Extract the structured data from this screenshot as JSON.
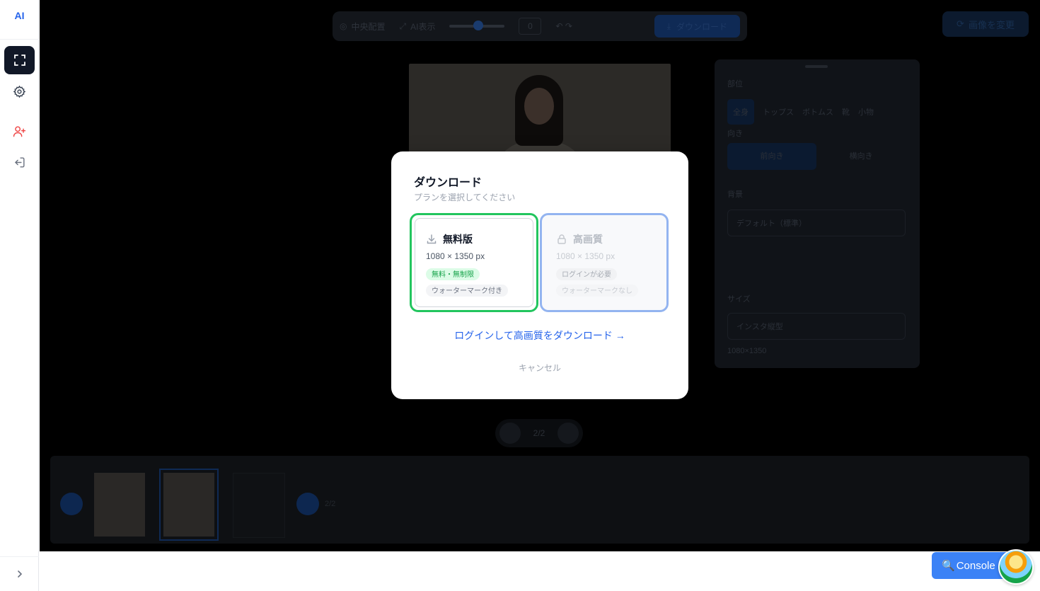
{
  "sidebar": {
    "logo": "AI",
    "items": [
      {
        "name": "fullscreen",
        "active": true
      },
      {
        "name": "settings"
      },
      {
        "name": "add-user"
      },
      {
        "name": "logout"
      }
    ]
  },
  "background_app": {
    "toolbar": {
      "center_label": "中央配置",
      "ai_label": "AI表示",
      "zoom_value": "0",
      "download_label": "ダウンロード"
    },
    "change_image_label": "画像を変更",
    "settings_panel": {
      "category_label": "部位",
      "categories": [
        "全身",
        "トップス",
        "ボトムス",
        "靴",
        "小物"
      ],
      "layout_label": "向き",
      "layout_options": [
        "前向き",
        "横向き"
      ],
      "background_label": "背景",
      "background_value": "デフォルト（標準）",
      "size_label": "サイズ",
      "size_value": "インスタ縦型",
      "size_dims": "1080×1350"
    },
    "pager": "2/2",
    "filmstrip_count": "2/2"
  },
  "modal": {
    "title": "ダウンロード",
    "subtitle": "プランを選択してください",
    "plans": [
      {
        "name": "無料版",
        "size": "1080 × 1350 px",
        "tag1": "無料・無制限",
        "tag2": "ウォーターマーク付き",
        "selected": true
      },
      {
        "name": "高画質",
        "size": "1080 × 1350 px",
        "tag1": "ログインが必要",
        "tag2": "ウォーターマークなし",
        "locked": true
      }
    ],
    "login_link": "ログインして高画質をダウンロード →",
    "cancel": "キャンセル"
  },
  "console_button": "Console",
  "colors": {
    "accent": "#2563eb",
    "free_border": "#22c55e",
    "hq_border": "#93b4f0",
    "console_bg": "#3b82f6"
  }
}
